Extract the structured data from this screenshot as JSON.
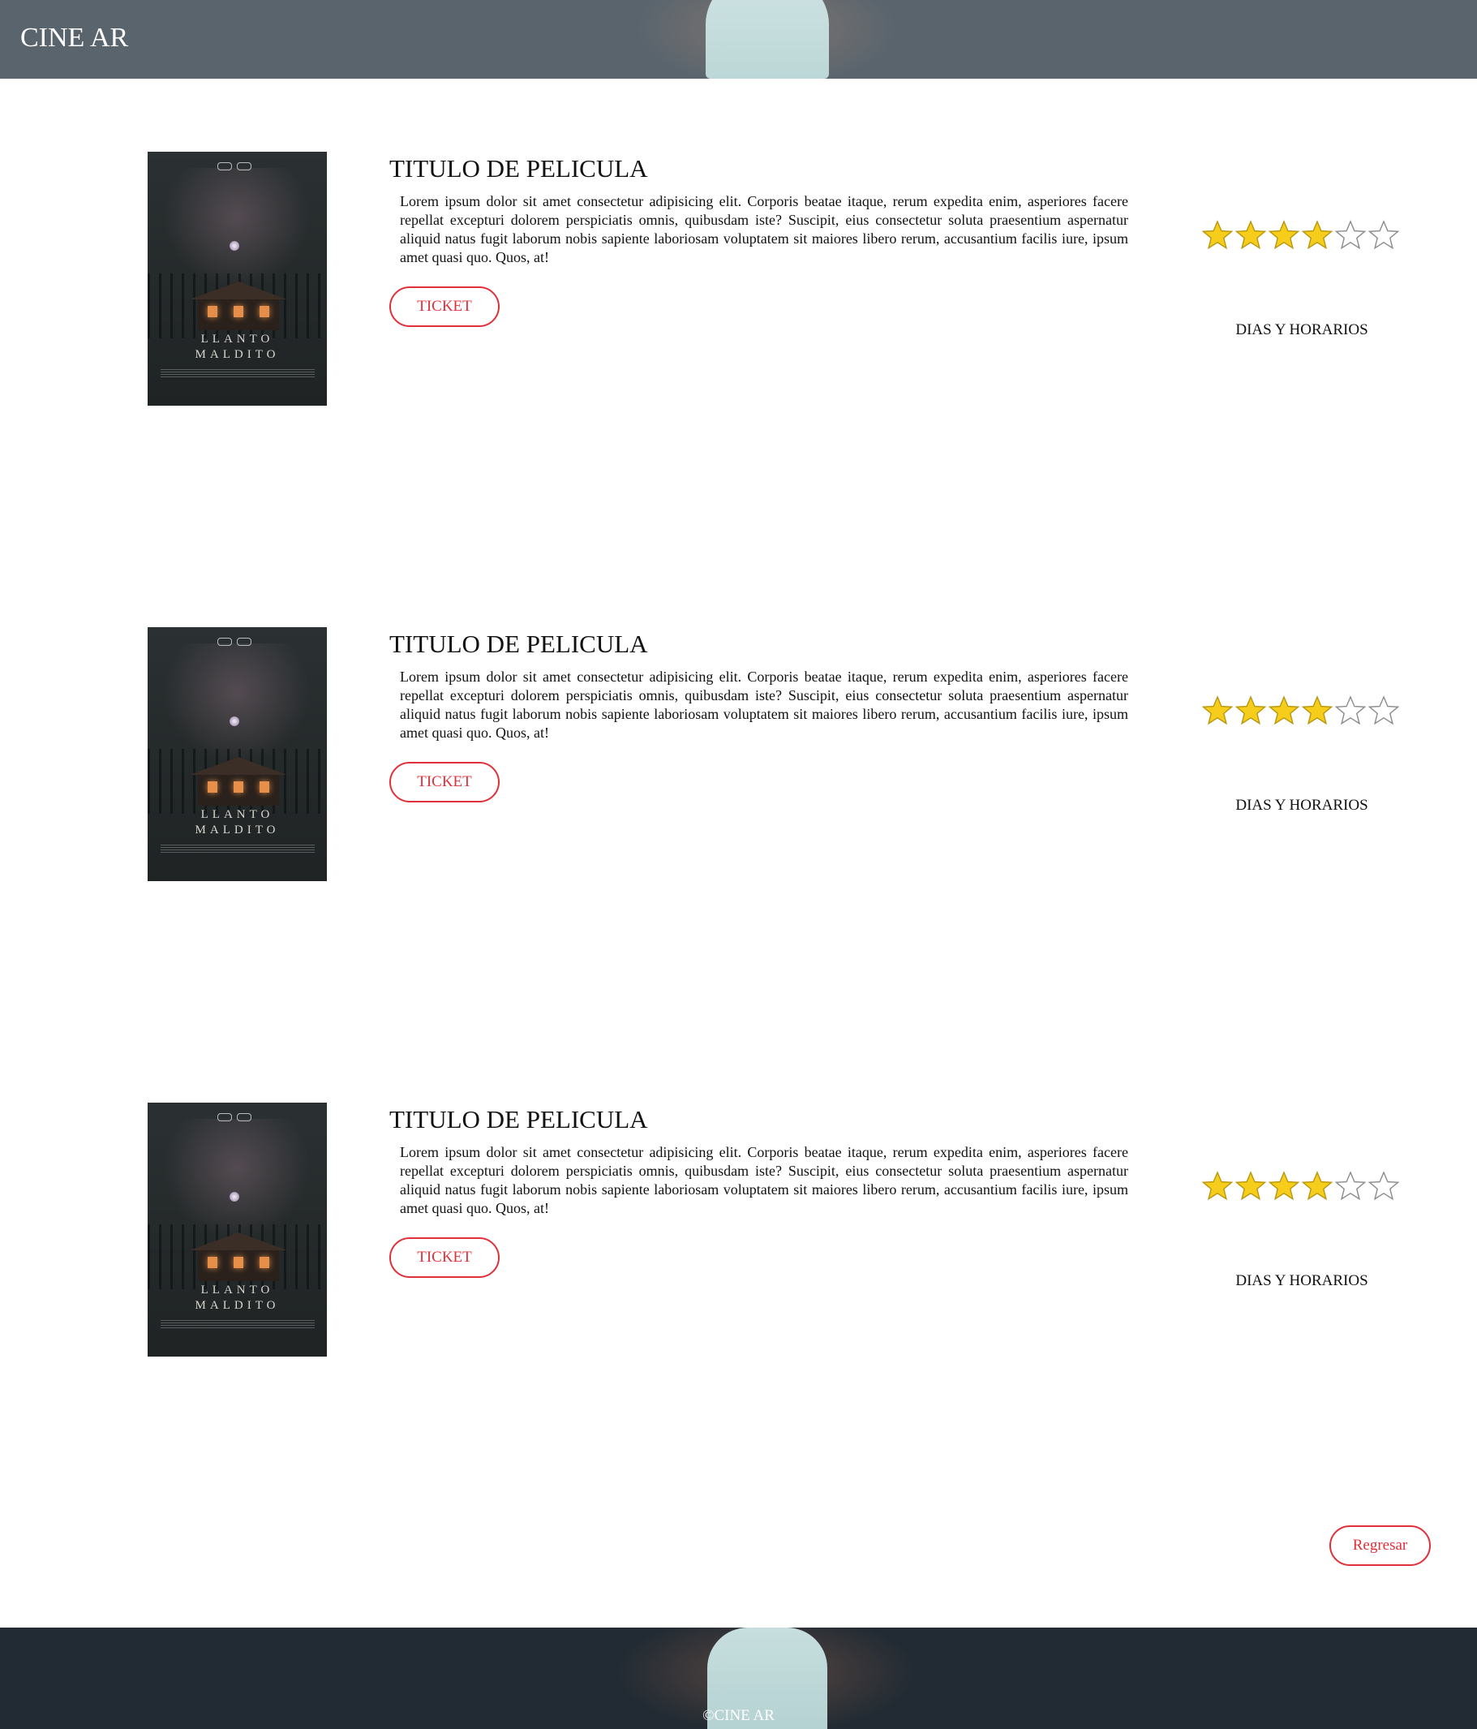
{
  "header": {
    "brand": "CINE AR"
  },
  "movies": [
    {
      "poster_title_line1": "LLANTO",
      "poster_title_line2": "MALDITO",
      "title": "TITULO DE PELICULA",
      "description": "Lorem ipsum dolor sit amet consectetur adipisicing elit. Corporis beatae itaque, rerum expedita enim, asperiores facere repellat excepturi dolorem perspiciatis omnis, quibusdam iste? Suscipit, eius consectetur soluta praesentium aspernatur aliquid natus fugit laborum nobis sapiente laboriosam voluptatem sit maiores libero rerum, accusantium facilis iure, ipsum amet quasi quo. Quos, at!",
      "ticket_label": "TICKET",
      "rating": 4,
      "rating_max": 6,
      "schedule_label": "DIAS Y HORARIOS"
    },
    {
      "poster_title_line1": "LLANTO",
      "poster_title_line2": "MALDITO",
      "title": "TITULO DE PELICULA",
      "description": "Lorem ipsum dolor sit amet consectetur adipisicing elit. Corporis beatae itaque, rerum expedita enim, asperiores facere repellat excepturi dolorem perspiciatis omnis, quibusdam iste? Suscipit, eius consectetur soluta praesentium aspernatur aliquid natus fugit laborum nobis sapiente laboriosam voluptatem sit maiores libero rerum, accusantium facilis iure, ipsum amet quasi quo. Quos, at!",
      "ticket_label": "TICKET",
      "rating": 4,
      "rating_max": 6,
      "schedule_label": "DIAS Y HORARIOS"
    },
    {
      "poster_title_line1": "LLANTO",
      "poster_title_line2": "MALDITO",
      "title": "TITULO DE PELICULA",
      "description": "Lorem ipsum dolor sit amet consectetur adipisicing elit. Corporis beatae itaque, rerum expedita enim, asperiores facere repellat excepturi dolorem perspiciatis omnis, quibusdam iste? Suscipit, eius consectetur soluta praesentium aspernatur aliquid natus fugit laborum nobis sapiente laboriosam voluptatem sit maiores libero rerum, accusantium facilis iure, ipsum amet quasi quo. Quos, at!",
      "ticket_label": "TICKET",
      "rating": 4,
      "rating_max": 6,
      "schedule_label": "DIAS Y HORARIOS"
    }
  ],
  "back_button": {
    "label": "Regresar"
  },
  "footer": {
    "copyright": "©CINE AR"
  },
  "colors": {
    "accent": "#e0303a",
    "header_bg": "#59646d",
    "footer_bg": "#222b33",
    "star_filled": "#f5cd1a",
    "star_empty_stroke": "#8a8a8a"
  },
  "icons": {
    "star_filled": "star-filled-icon",
    "star_empty": "star-empty-icon"
  }
}
